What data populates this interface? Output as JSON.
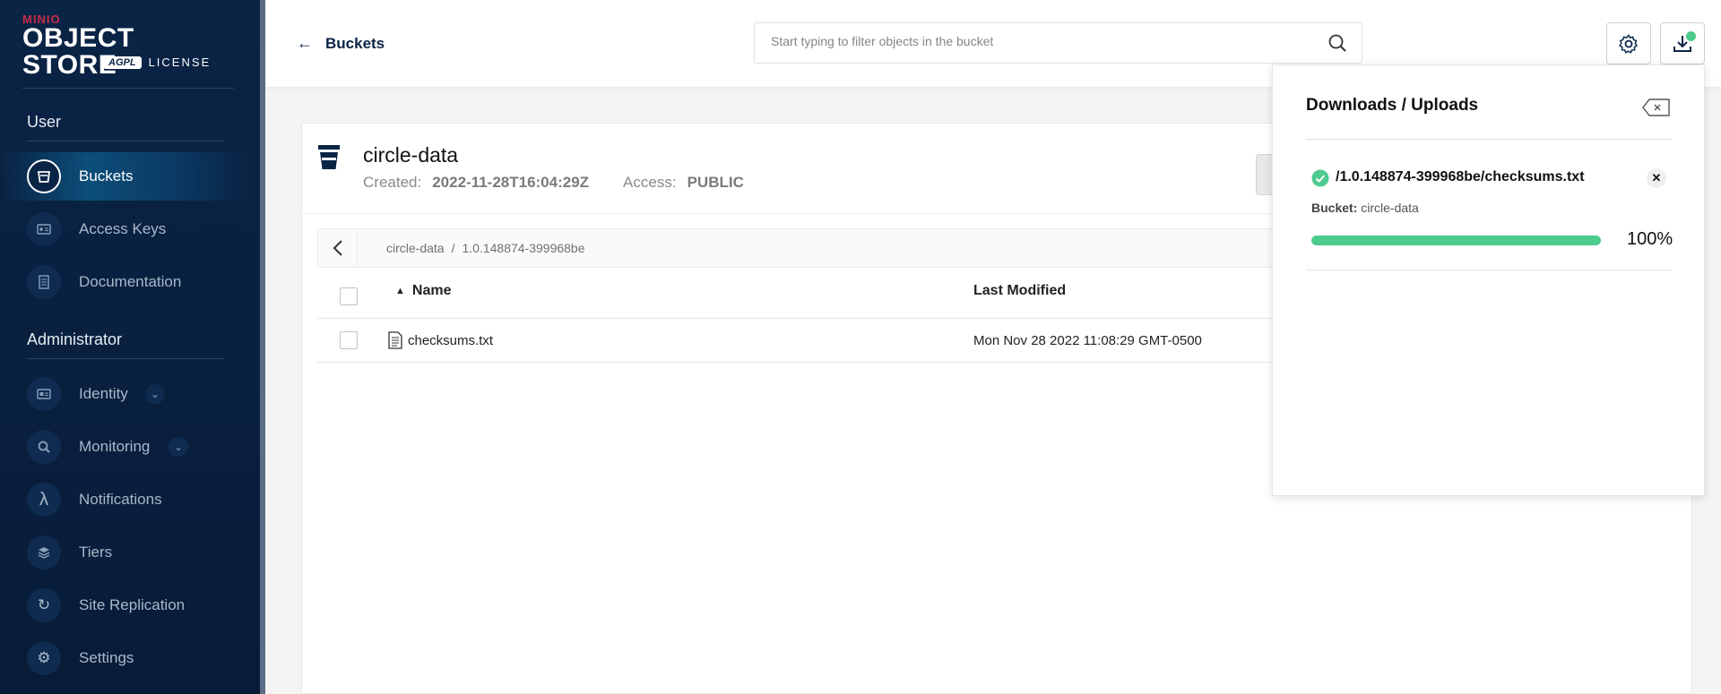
{
  "logo": {
    "brand": "MINIO",
    "product": "OBJECT STORE",
    "badge": "AGPL",
    "license": "LICENSE"
  },
  "sidebar": {
    "user_section": "User",
    "admin_section": "Administrator",
    "user_items": [
      {
        "label": "Buckets",
        "icon": "bucket-icon",
        "active": true
      },
      {
        "label": "Access Keys",
        "icon": "key-card-icon"
      },
      {
        "label": "Documentation",
        "icon": "document-icon"
      }
    ],
    "admin_items": [
      {
        "label": "Identity",
        "icon": "id-card-icon",
        "expandable": true
      },
      {
        "label": "Monitoring",
        "icon": "magnifier-icon",
        "expandable": true
      },
      {
        "label": "Notifications",
        "icon": "lambda-icon"
      },
      {
        "label": "Tiers",
        "icon": "layers-icon"
      },
      {
        "label": "Site Replication",
        "icon": "sync-icon"
      },
      {
        "label": "Settings",
        "icon": "gear-icon"
      }
    ]
  },
  "topbar": {
    "back_label": "Buckets",
    "search_placeholder": "Start typing to filter objects in the bucket"
  },
  "bucket": {
    "name": "circle-data",
    "created_label": "Created:",
    "created_value": "2022-11-28T16:04:29Z",
    "access_label": "Access:",
    "access_value": "PUBLIC"
  },
  "breadcrumb": {
    "root": "circle-data",
    "separator": "/",
    "folder": "1.0.148874-399968be"
  },
  "table": {
    "columns": [
      "Name",
      "Last Modified"
    ],
    "rows": [
      {
        "name": "checksums.txt",
        "modified": "Mon Nov 28 2022 11:08:29 GMT-0500"
      }
    ]
  },
  "downloads_panel": {
    "title": "Downloads / Uploads",
    "item": {
      "path": "/1.0.148874-399968be/checksums.txt",
      "bucket_label": "Bucket:",
      "bucket_value": "circle-data",
      "progress": 100,
      "progress_text": "100%"
    }
  },
  "colors": {
    "sidebar_bg": "#0a2446",
    "accent_green": "#4ccb8d",
    "brand_red": "#c72c48"
  }
}
